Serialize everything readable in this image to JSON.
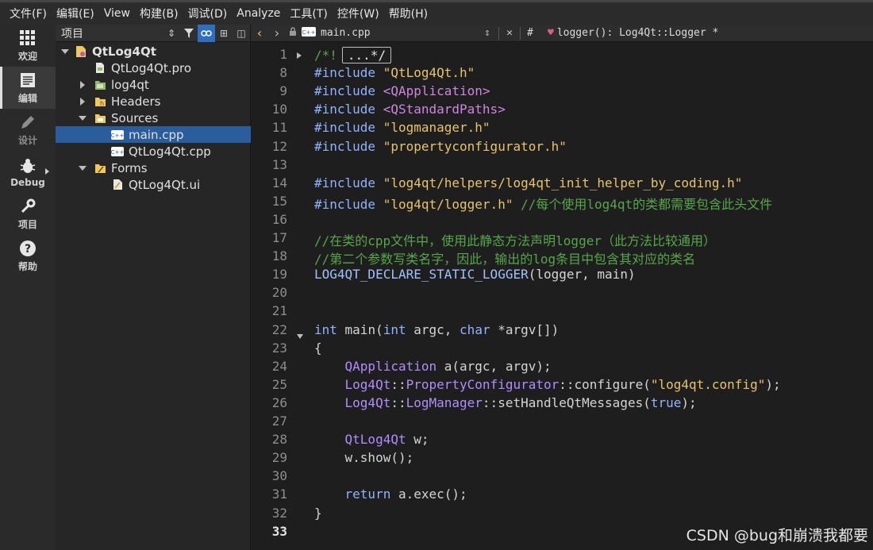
{
  "menubar": {
    "items": [
      "文件(F)",
      "编辑(E)",
      "View",
      "构建(B)",
      "调试(D)",
      "Analyze",
      "工具(T)",
      "控件(W)",
      "帮助(H)"
    ]
  },
  "modes": [
    {
      "label": "欢迎",
      "icon": "grid-icon"
    },
    {
      "label": "编辑",
      "icon": "document-icon"
    },
    {
      "label": "设计",
      "icon": "pencil-icon"
    },
    {
      "label": "Debug",
      "icon": "bug-icon"
    },
    {
      "label": "项目",
      "icon": "wrench-icon"
    },
    {
      "label": "帮助",
      "icon": "help-icon"
    }
  ],
  "project_panel": {
    "title": "项目",
    "tree": [
      {
        "label": "QtLog4Qt",
        "level": 0,
        "expanded": true,
        "icon": "project-icon"
      },
      {
        "label": "QtLog4Qt.pro",
        "level": 1,
        "icon": "pro-file-icon"
      },
      {
        "label": "log4qt",
        "level": 1,
        "expanded": false,
        "icon": "folder-icon"
      },
      {
        "label": "Headers",
        "level": 1,
        "expanded": false,
        "icon": "folder-icon"
      },
      {
        "label": "Sources",
        "level": 1,
        "expanded": true,
        "icon": "folder-icon"
      },
      {
        "label": "main.cpp",
        "level": 2,
        "icon": "cpp-file-icon",
        "selected": true
      },
      {
        "label": "QtLog4Qt.cpp",
        "level": 2,
        "icon": "cpp-file-icon"
      },
      {
        "label": "Forms",
        "level": 1,
        "expanded": true,
        "icon": "folder-icon"
      },
      {
        "label": "QtLog4Qt.ui",
        "level": 2,
        "icon": "ui-file-icon"
      }
    ]
  },
  "editor": {
    "file_name": "main.cpp",
    "hash": "#",
    "symbol": "logger(): Log4Qt::Logger *",
    "line_numbers": [
      "1",
      "8",
      "9",
      "10",
      "11",
      "12",
      "13",
      "14",
      "15",
      "16",
      "17",
      "18",
      "19",
      "20",
      "21",
      "22",
      "23",
      "24",
      "25",
      "26",
      "27",
      "28",
      "29",
      "30",
      "31",
      "32",
      "33"
    ],
    "current_line": "33",
    "folded_marker": "...*/",
    "lines": [
      "/*!",
      "#include \"QtLog4Qt.h\"",
      "#include <QApplication>",
      "#include <QStandardPaths>",
      "#include \"logmanager.h\"",
      "#include \"propertyconfigurator.h\"",
      "",
      "#include \"log4qt/helpers/log4qt_init_helper_by_coding.h\"",
      "#include \"log4qt/logger.h\" //每个使用log4qt的类都需要包含此头文件",
      "",
      "//在类的cpp文件中，使用此静态方法声明logger（此方法比较通用）",
      "//第二个参数写类名字，因此，输出的log条目中包含其对应的类名",
      "LOG4QT_DECLARE_STATIC_LOGGER(logger, main)",
      "",
      "",
      "int main(int argc, char *argv[])",
      "{",
      "    QApplication a(argc, argv);",
      "    Log4Qt::PropertyConfigurator::configure(\"log4qt.config\");",
      "    Log4Qt::LogManager::setHandleQtMessages(true);",
      "",
      "    QtLog4Qt w;",
      "    w.show();",
      "",
      "    return a.exec();",
      "}",
      ""
    ]
  },
  "watermark": "CSDN @bug和崩溃我都要"
}
